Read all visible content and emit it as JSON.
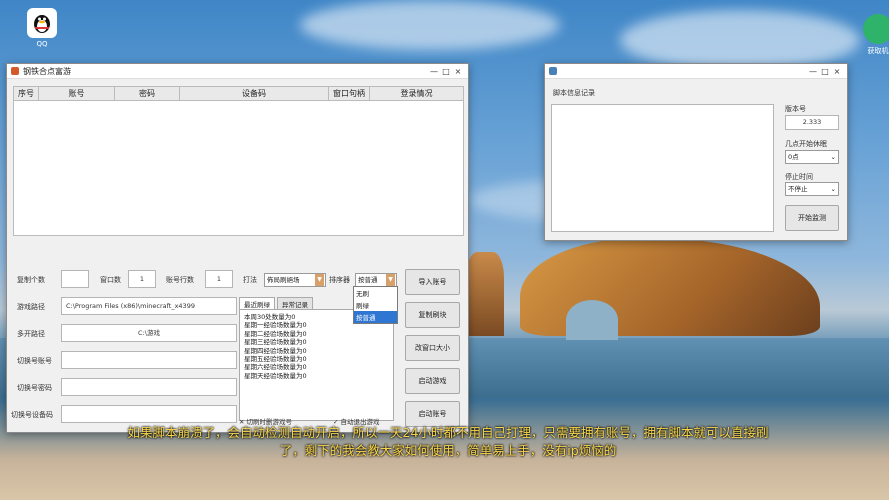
{
  "desktop": {
    "icons": [
      {
        "label": "QQ"
      },
      {
        "label": "获取机"
      }
    ]
  },
  "main_window": {
    "title": "钢铁合点富游",
    "controls": {
      "minimize": "—",
      "maximize": "□",
      "close": "×"
    },
    "table_columns": [
      "序号",
      "账号",
      "密码",
      "设备码",
      "窗口句柄",
      "登录情况"
    ],
    "fields": {
      "copy_count_label": "复制个数",
      "window_count_label": "窗口数",
      "window_count_value": "1",
      "rows_label": "账号行数",
      "rows_value": "1",
      "launcher_path_label": "游戏路径",
      "launcher_path_value": "C:\\Program Files (x86)\\minecraft_x4399",
      "multi_path_label": "多开路径",
      "multi_path_value": "C:\\游戏",
      "account_label": "切换号账号",
      "password_label": "切换号密码",
      "device_label": "切换号设备码"
    },
    "combo": {
      "mode_label": "打法",
      "mode_value": "佈局刷絕场",
      "sort_label": "排序器",
      "sort_value": "按普通",
      "options": [
        "无刷",
        "刷绿",
        "按普通"
      ],
      "selected_index": 2
    },
    "tabs": [
      "最近刷绿",
      "异常记录"
    ],
    "log_lines": [
      "本周30处数量为0",
      "星期一经验场数量为0",
      "星期二经验场数量为0",
      "星期三经验场数量为0",
      "星期四经验场数量为0",
      "星期五经验场数量为0",
      "星期六经验场数量为0",
      "星期天经验场数量为0"
    ],
    "buttons": [
      "导入账号",
      "复制刷块",
      "改窗口大小",
      "启动游戏",
      "启动账号"
    ],
    "checkboxes": [
      {
        "label": "切刷时删游戏号",
        "checked": true
      },
      {
        "label": "自动退出游戏",
        "checked": true
      }
    ]
  },
  "record_window": {
    "title": "",
    "log_label": "脚本信息记录",
    "version_label": "版本号",
    "version_value": "2.333",
    "rest_label": "几点开始休眠",
    "rest_value": "0点",
    "stop_label": "停止时间",
    "stop_value": "不停止",
    "start_button": "开始监测"
  },
  "subtitle": "如果脚本崩溃了，会自动检测自动开启，所以一天24小时都不用自己打理，只需要拥有账号，拥有脚本就可以直接刷了，剩下的我会教大家如何使用，简单易上手，没有ip烦恼的"
}
